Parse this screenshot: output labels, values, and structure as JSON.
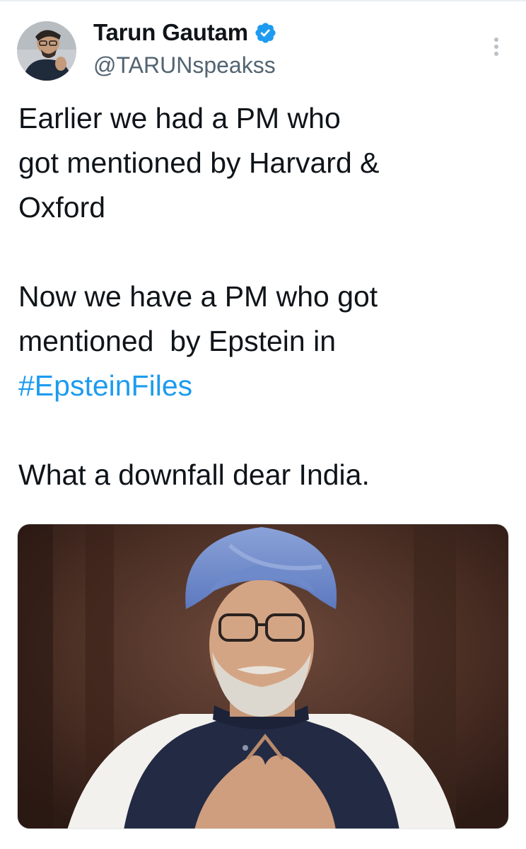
{
  "tweet": {
    "author": {
      "display_name": "Tarun Gautam",
      "handle": "@TARUNspeakss",
      "verified_icon": "verified-badge-icon"
    },
    "menu_icon": "more-options-icon",
    "text": {
      "line_group_1": "Earlier we had a PM who\ngot mentioned by Harvard &\nOxford",
      "line_group_2_text": "Now we have a PM who got\nmentioned  by Epstein in\n",
      "hashtag": "#EpsteinFiles",
      "line_group_3": "What a downfall dear India."
    },
    "media": {
      "type": "photo"
    }
  },
  "colors": {
    "text_primary": "#0f1419",
    "text_secondary": "#536471",
    "link": "#1d9bf0",
    "verified": "#1d9bf0"
  }
}
